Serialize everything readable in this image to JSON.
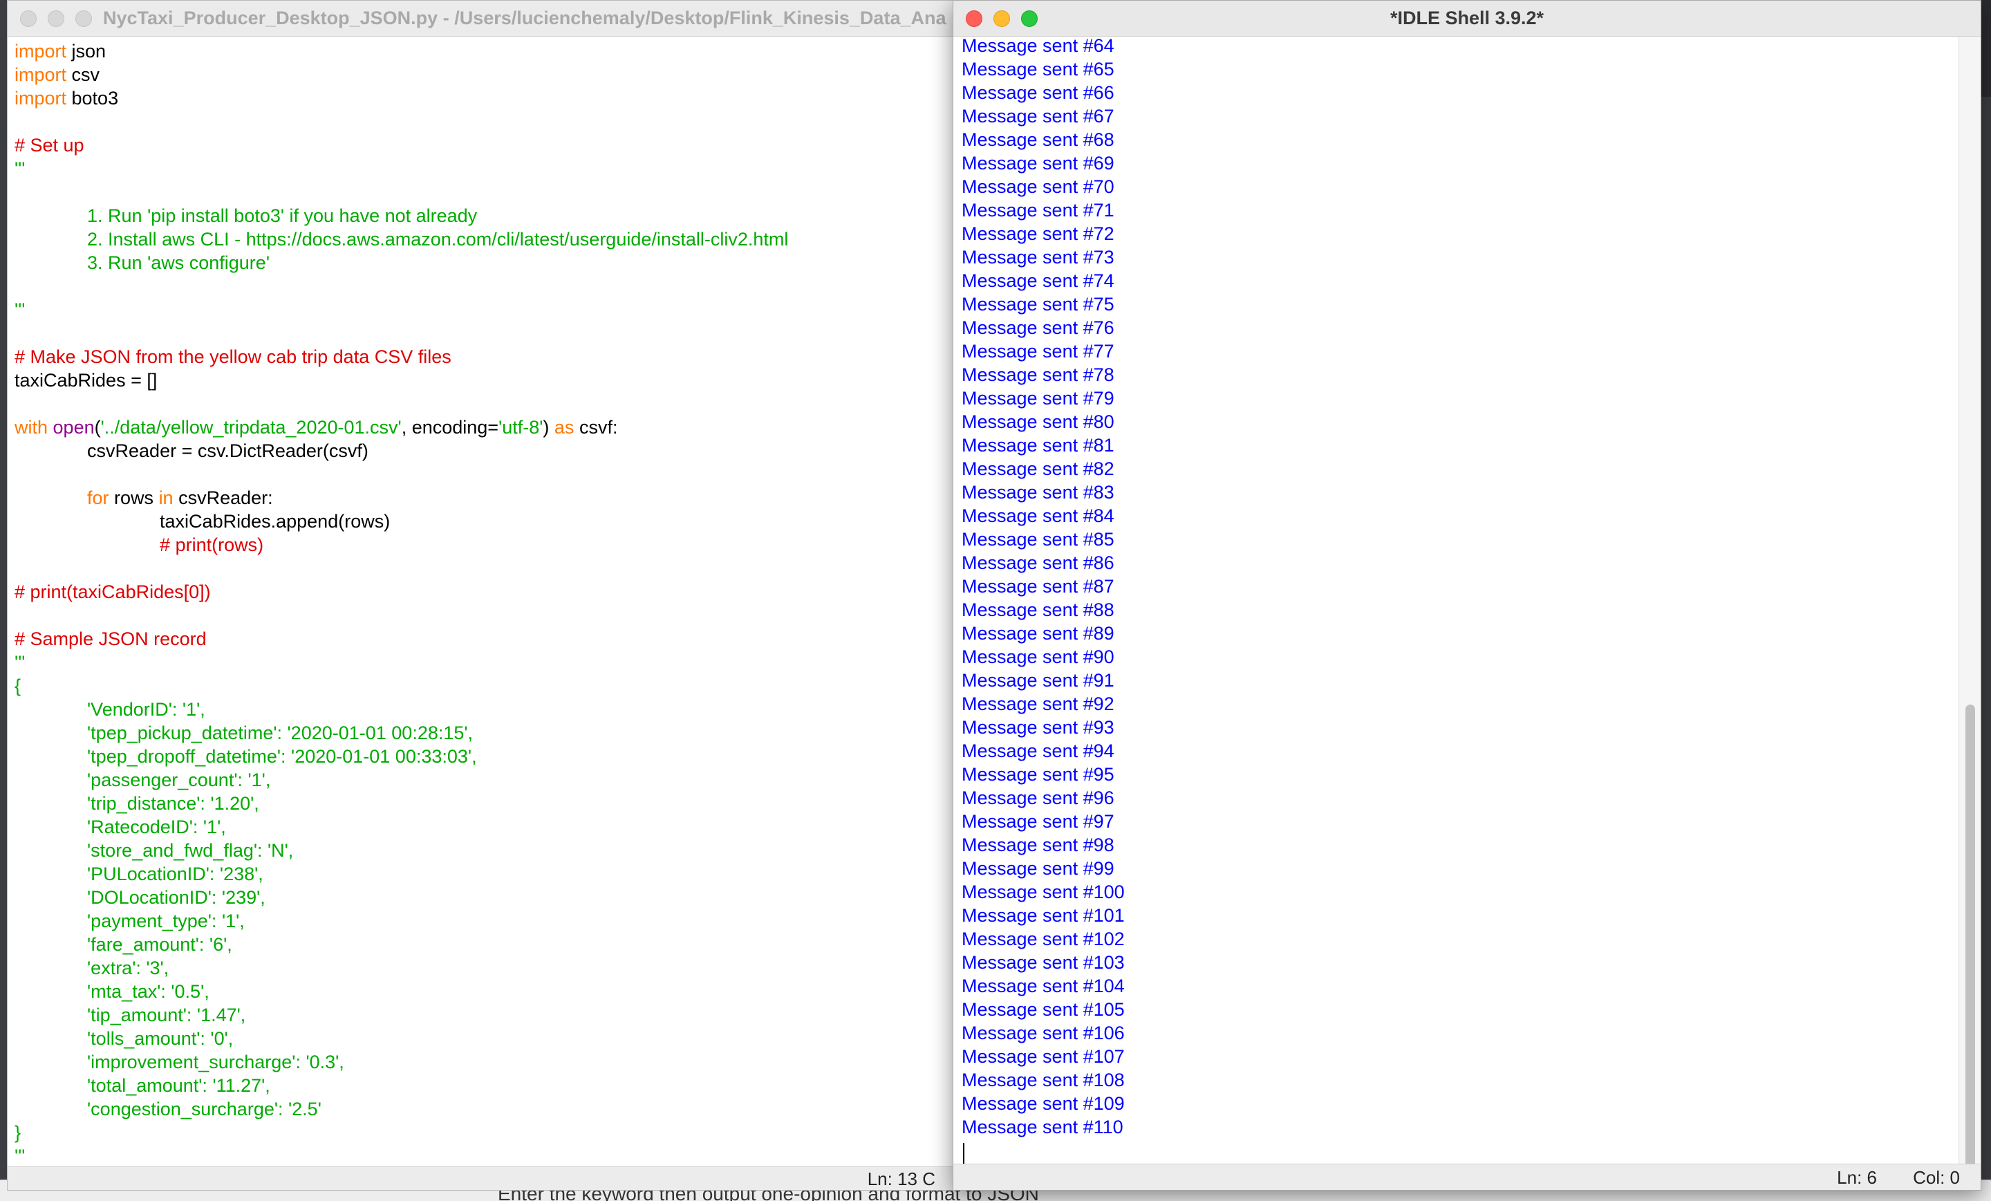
{
  "editor": {
    "title": "NycTaxi_Producer_Desktop_JSON.py - /Users/lucienchemaly/Desktop/Flink_Kinesis_Data_Ana",
    "status": "Ln: 13   C",
    "code_lines": [
      [
        [
          "kw",
          "import"
        ],
        [
          "pl",
          " json"
        ]
      ],
      [
        [
          "kw",
          "import"
        ],
        [
          "pl",
          " csv"
        ]
      ],
      [
        [
          "kw",
          "import"
        ],
        [
          "pl",
          " boto3"
        ]
      ],
      [],
      [
        [
          "com",
          "# Set up"
        ]
      ],
      [
        [
          "str",
          "'''"
        ]
      ],
      [],
      [
        [
          "str",
          "              1. Run 'pip install boto3' if you have not already"
        ]
      ],
      [
        [
          "str",
          "              2. Install aws CLI - https://docs.aws.amazon.com/cli/latest/userguide/install-cliv2.html"
        ]
      ],
      [
        [
          "str",
          "              3. Run 'aws configure'"
        ]
      ],
      [],
      [
        [
          "str",
          "'''"
        ]
      ],
      [],
      [
        [
          "com",
          "# Make JSON from the yellow cab trip data CSV files"
        ]
      ],
      [
        [
          "pl",
          "taxiCabRides = []"
        ]
      ],
      [],
      [
        [
          "kw",
          "with"
        ],
        [
          "pl",
          " "
        ],
        [
          "bi",
          "open"
        ],
        [
          "pl",
          "("
        ],
        [
          "str",
          "'../data/yellow_tripdata_2020-01.csv'"
        ],
        [
          "pl",
          ", encoding="
        ],
        [
          "str",
          "'utf-8'"
        ],
        [
          "pl",
          ") "
        ],
        [
          "kw",
          "as"
        ],
        [
          "pl",
          " csvf:"
        ]
      ],
      [
        [
          "pl",
          "              csvReader = csv.DictReader(csvf)"
        ]
      ],
      [],
      [
        [
          "pl",
          "              "
        ],
        [
          "kw",
          "for"
        ],
        [
          "pl",
          " rows "
        ],
        [
          "kw",
          "in"
        ],
        [
          "pl",
          " csvReader:"
        ]
      ],
      [
        [
          "pl",
          "                            taxiCabRides.append(rows)"
        ]
      ],
      [
        [
          "pl",
          "                            "
        ],
        [
          "com",
          "# print(rows)"
        ]
      ],
      [],
      [
        [
          "com",
          "# print(taxiCabRides[0])"
        ]
      ],
      [],
      [
        [
          "com",
          "# Sample JSON record"
        ]
      ],
      [
        [
          "str",
          "'''"
        ]
      ],
      [
        [
          "str",
          "{"
        ]
      ],
      [
        [
          "str",
          "              'VendorID': '1',"
        ]
      ],
      [
        [
          "str",
          "              'tpep_pickup_datetime': '2020-01-01 00:28:15',"
        ]
      ],
      [
        [
          "str",
          "              'tpep_dropoff_datetime': '2020-01-01 00:33:03',"
        ]
      ],
      [
        [
          "str",
          "              'passenger_count': '1',"
        ]
      ],
      [
        [
          "str",
          "              'trip_distance': '1.20',"
        ]
      ],
      [
        [
          "str",
          "              'RatecodeID': '1',"
        ]
      ],
      [
        [
          "str",
          "              'store_and_fwd_flag': 'N',"
        ]
      ],
      [
        [
          "str",
          "              'PULocationID': '238',"
        ]
      ],
      [
        [
          "str",
          "              'DOLocationID': '239',"
        ]
      ],
      [
        [
          "str",
          "              'payment_type': '1',"
        ]
      ],
      [
        [
          "str",
          "              'fare_amount': '6',"
        ]
      ],
      [
        [
          "str",
          "              'extra': '3',"
        ]
      ],
      [
        [
          "str",
          "              'mta_tax': '0.5',"
        ]
      ],
      [
        [
          "str",
          "              'tip_amount': '1.47',"
        ]
      ],
      [
        [
          "str",
          "              'tolls_amount': '0',"
        ]
      ],
      [
        [
          "str",
          "              'improvement_surcharge': '0.3',"
        ]
      ],
      [
        [
          "str",
          "              'total_amount': '11.27',"
        ]
      ],
      [
        [
          "str",
          "              'congestion_surcharge': '2.5'"
        ]
      ],
      [
        [
          "str",
          "}"
        ]
      ],
      [
        [
          "str",
          "'''"
        ]
      ]
    ]
  },
  "shell": {
    "title": "*IDLE Shell 3.9.2*",
    "status_ln": "Ln: 6",
    "status_col": "Col: 0",
    "lines": [
      "Message sent #64",
      "Message sent #65",
      "Message sent #66",
      "Message sent #67",
      "Message sent #68",
      "Message sent #69",
      "Message sent #70",
      "Message sent #71",
      "Message sent #72",
      "Message sent #73",
      "Message sent #74",
      "Message sent #75",
      "Message sent #76",
      "Message sent #77",
      "Message sent #78",
      "Message sent #79",
      "Message sent #80",
      "Message sent #81",
      "Message sent #82",
      "Message sent #83",
      "Message sent #84",
      "Message sent #85",
      "Message sent #86",
      "Message sent #87",
      "Message sent #88",
      "Message sent #89",
      "Message sent #90",
      "Message sent #91",
      "Message sent #92",
      "Message sent #93",
      "Message sent #94",
      "Message sent #95",
      "Message sent #96",
      "Message sent #97",
      "Message sent #98",
      "Message sent #99",
      "Message sent #100",
      "Message sent #101",
      "Message sent #102",
      "Message sent #103",
      "Message sent #104",
      "Message sent #105",
      "Message sent #106",
      "Message sent #107",
      "Message sent #108",
      "Message sent #109",
      "Message sent #110"
    ]
  },
  "background": {
    "partial_text": "Enter the keyword then output one-opinion and format to JSON"
  },
  "colors": {
    "keyword": "#ff7700",
    "string": "#00aa00",
    "comment": "#dd0000",
    "builtin": "#900090",
    "shell_output": "#0000ff"
  },
  "icons": {
    "close": "red-circle",
    "minimize": "yellow-circle",
    "zoom": "green-circle"
  }
}
